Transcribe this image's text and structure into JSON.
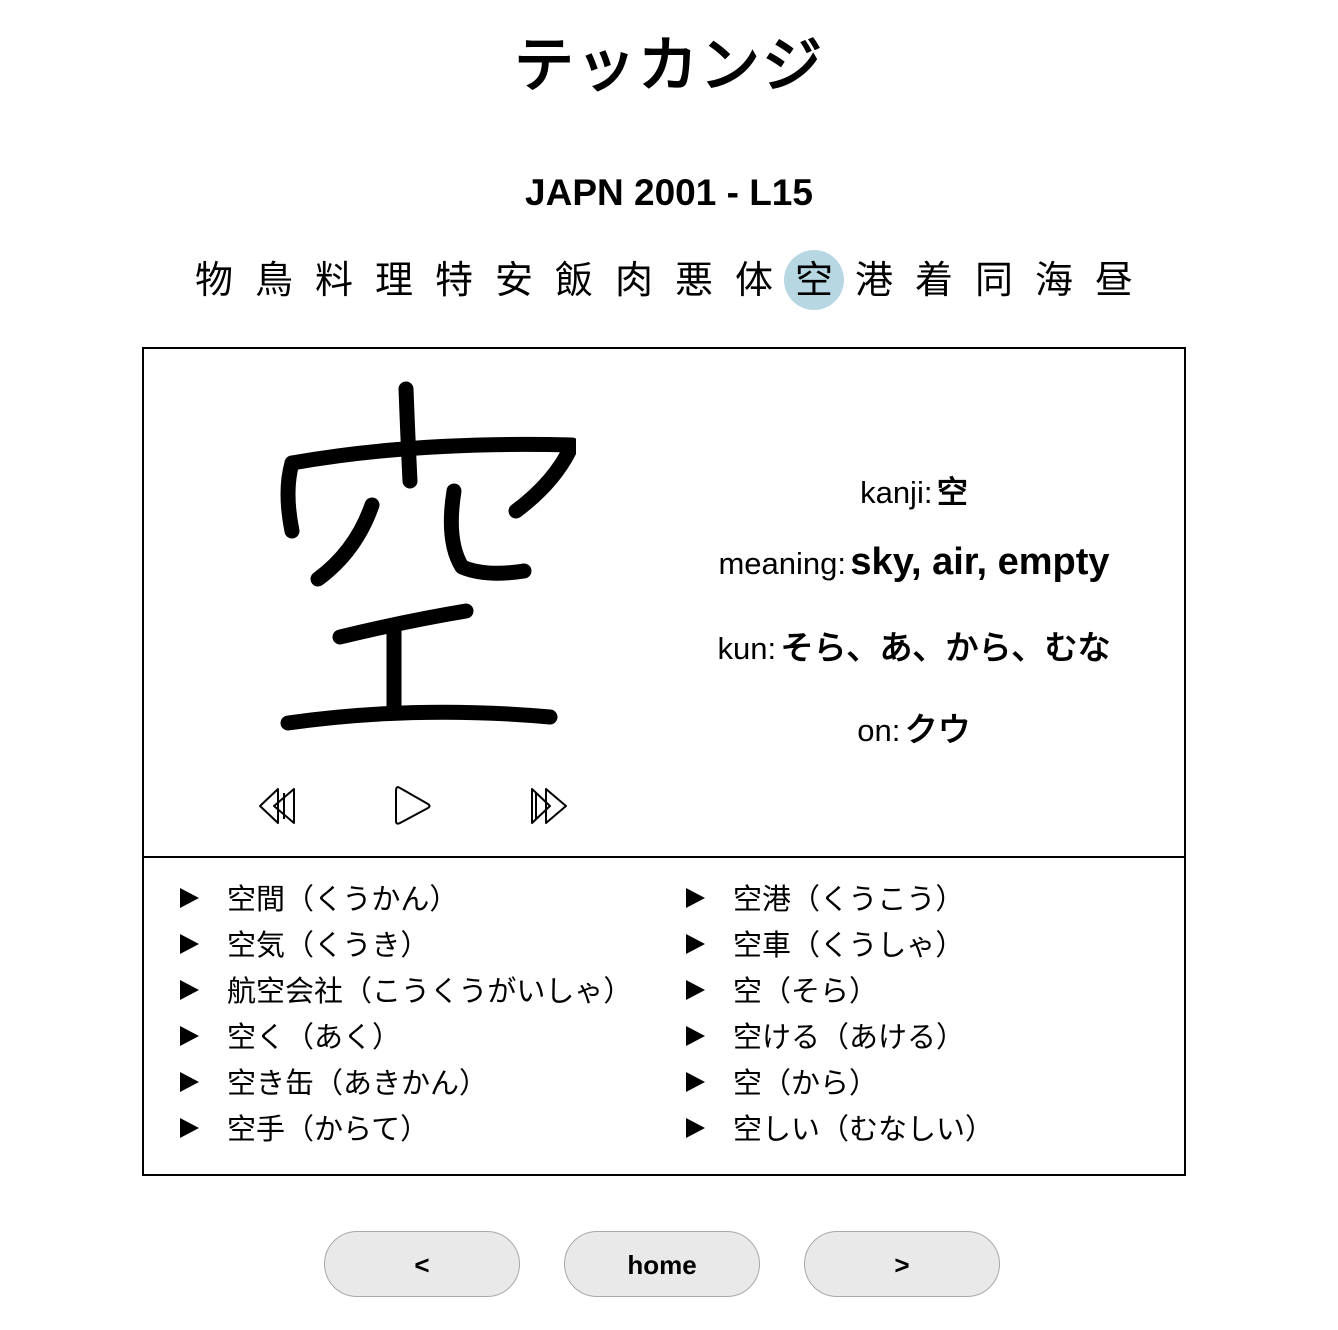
{
  "app": {
    "title": "テッカンジ"
  },
  "lesson": {
    "title": "JAPN 2001 - L15"
  },
  "kanji_nav": {
    "items": [
      "物",
      "鳥",
      "料",
      "理",
      "特",
      "安",
      "飯",
      "肉",
      "悪",
      "体",
      "空",
      "港",
      "着",
      "同",
      "海",
      "昼"
    ],
    "active_index": 10,
    "active_color": "#b7d7e3"
  },
  "stroke_player": {
    "controls": [
      "rewind-icon",
      "play-icon",
      "fast-forward-icon"
    ]
  },
  "info": {
    "kanji_label": "kanji:",
    "kanji_value": "空",
    "meaning_label": "meaning:",
    "meaning_value": "sky, air, empty",
    "kun_label": "kun:",
    "kun_value": "そら、あ、から、むな",
    "on_label": "on:",
    "on_value": "クウ"
  },
  "vocab": {
    "left": [
      "空間（くうかん）",
      "空気（くうき）",
      "航空会社（こうくうがいしゃ）",
      "空く（あく）",
      "空き缶（あきかん）",
      "空手（からて）"
    ],
    "right": [
      "空港（くうこう）",
      "空車（くうしゃ）",
      "空（そら）",
      "空ける（あける）",
      "空（から）",
      "空しい（むなしい）"
    ]
  },
  "nav_buttons": {
    "prev_label": "<",
    "home_label": "home",
    "next_label": ">"
  }
}
